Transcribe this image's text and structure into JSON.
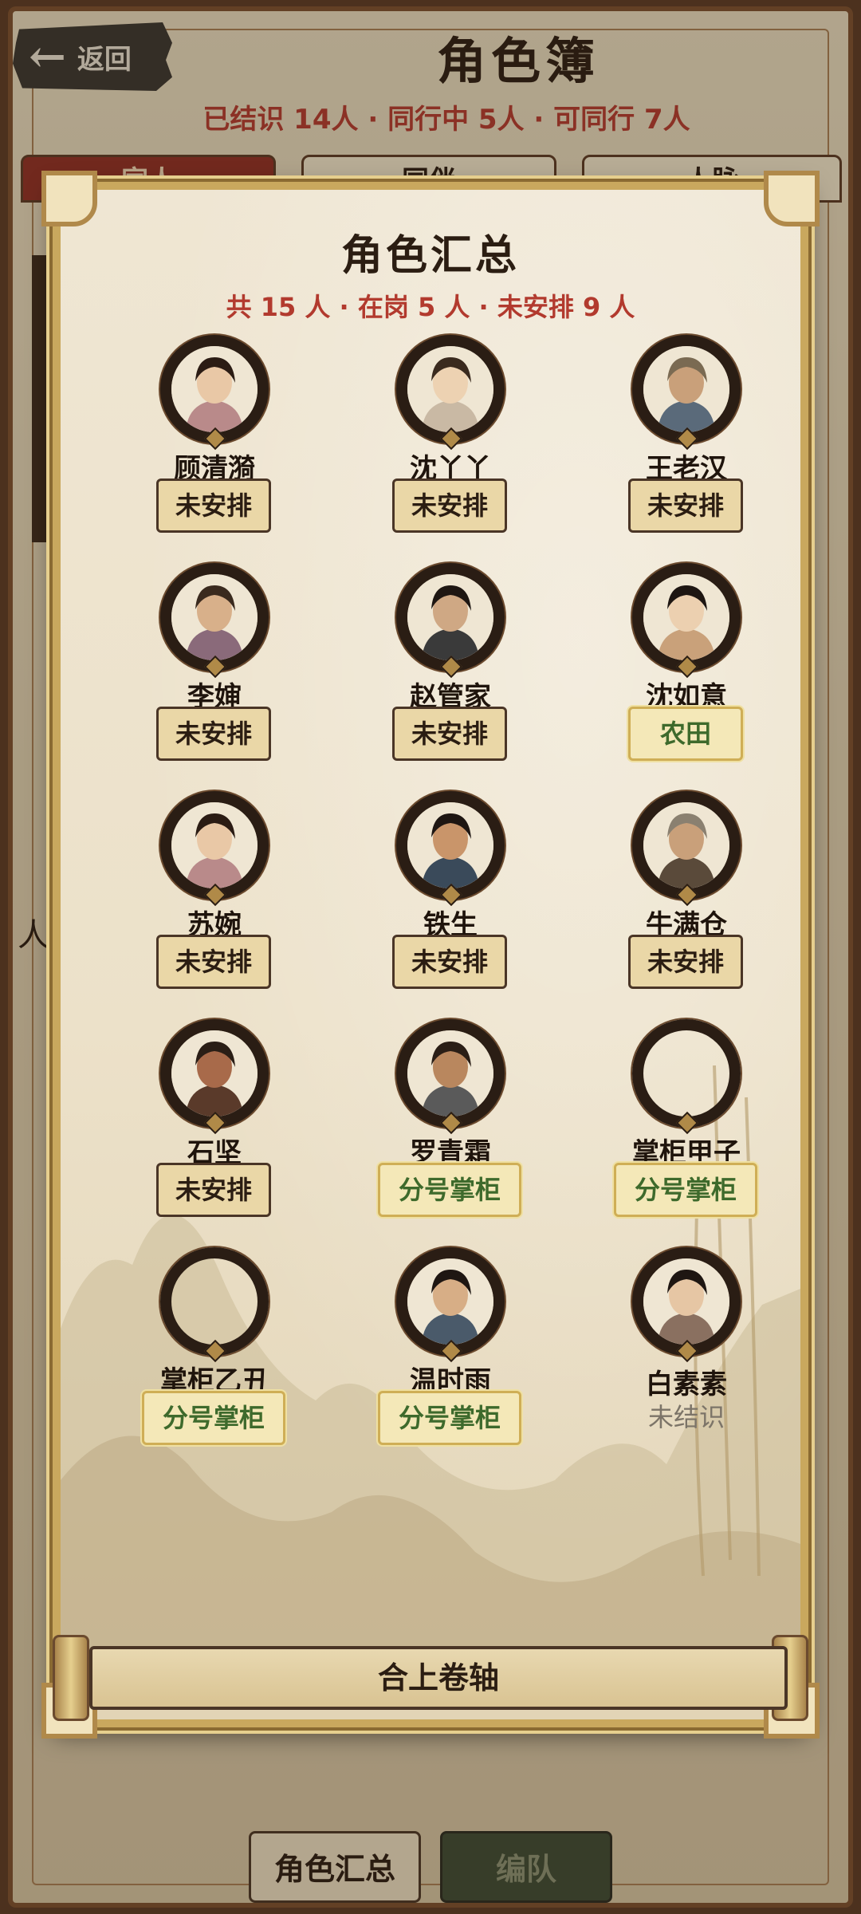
{
  "header": {
    "back_label": "返回",
    "title": "角色簿",
    "subtitle": "已结识 14人 · 同行中 5人 · 可同行 7人"
  },
  "bg_tabs": [
    "家人",
    "同伴",
    "人脉"
  ],
  "bg_side_char": "人",
  "bottom_bar": {
    "summary_label": "角色汇总",
    "team_label": "编队"
  },
  "modal": {
    "title": "角色汇总",
    "stats": "共 15 人 · 在岗 5 人 · 未安排 9 人",
    "close_label": "合上卷轴",
    "characters": [
      {
        "name": "顾清漪",
        "status": "未安排",
        "portrait": "young-woman-portrait"
      },
      {
        "name": "沈丫丫",
        "status": "未安排",
        "portrait": "girl-portrait"
      },
      {
        "name": "王老汉",
        "status": "未安排",
        "portrait": "old-farmer-portrait"
      },
      {
        "name": "李婶",
        "status": "未安排",
        "portrait": "middle-aged-woman-portrait"
      },
      {
        "name": "赵管家",
        "status": "未安排",
        "portrait": "steward-portrait"
      },
      {
        "name": "沈如意",
        "status": "农田",
        "portrait": "lady-portrait"
      },
      {
        "name": "苏婉",
        "status": "未安排",
        "portrait": "young-woman-portrait"
      },
      {
        "name": "铁生",
        "status": "未安排",
        "portrait": "young-man-portrait"
      },
      {
        "name": "牛满仓",
        "status": "未安排",
        "portrait": "elder-man-portrait"
      },
      {
        "name": "石坚",
        "status": "未安排",
        "portrait": "warrior-portrait"
      },
      {
        "name": "罗青霜",
        "status": "分号掌柜",
        "portrait": "swordsman-portrait"
      },
      {
        "name": "掌柜甲子",
        "status": "分号掌柜",
        "portrait": ""
      },
      {
        "name": "掌柜乙丑",
        "status": "分号掌柜",
        "portrait": ""
      },
      {
        "name": "温时雨",
        "status": "分号掌柜",
        "portrait": "scholar-portrait"
      },
      {
        "name": "白素素",
        "status": "未结识",
        "portrait": "maiden-portrait"
      }
    ]
  },
  "colors": {
    "accent_red": "#b23a2e",
    "assigned_green": "#3e6a2c",
    "parchment": "#ece1c9",
    "frame_gold": "#c9a85e"
  }
}
